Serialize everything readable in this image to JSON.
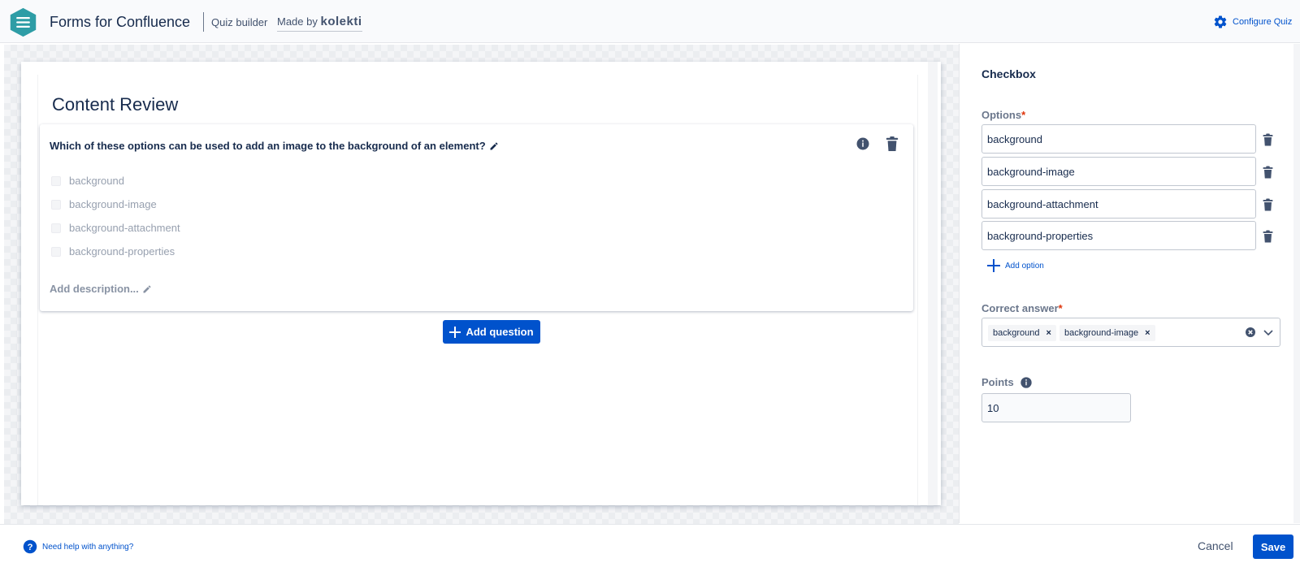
{
  "header": {
    "app_title": "Forms for Confluence",
    "mode_label": "Quiz builder",
    "made_by_prefix": "Made by",
    "made_by_brand": "kolekti",
    "configure_label": "Configure Quiz"
  },
  "form": {
    "title": "Content Review",
    "question": {
      "text": "Which of these options can be used to add an image to the background of an element?",
      "options": [
        "background",
        "background-image",
        "background-attachment",
        "background-properties"
      ],
      "add_description": "Add description..."
    },
    "add_question_label": "Add question"
  },
  "panel": {
    "title": "Checkbox",
    "options_label": "Options",
    "options": [
      "background",
      "background-image",
      "background-attachment",
      "background-properties"
    ],
    "add_option_label": "Add option",
    "correct_answer_label": "Correct answer",
    "correct_answers": [
      "background",
      "background-image"
    ],
    "points_label": "Points",
    "points_value": "10"
  },
  "footer": {
    "help_label": "Need help with anything?",
    "cancel_label": "Cancel",
    "save_label": "Save"
  },
  "colors": {
    "primary": "#0052cc",
    "text": "#172b4d",
    "required": "#de350b",
    "logo": "#2e9da6"
  }
}
